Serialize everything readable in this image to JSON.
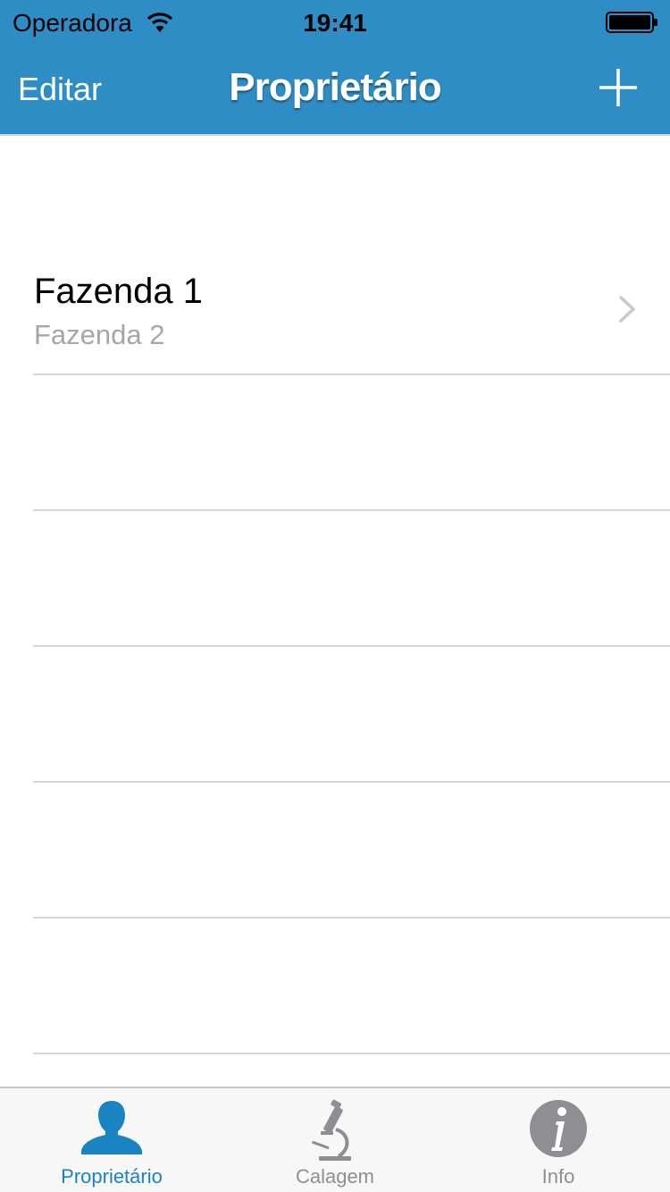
{
  "status_bar": {
    "carrier": "Operadora",
    "time": "19:41"
  },
  "nav_bar": {
    "edit_label": "Editar",
    "title": "Proprietário",
    "add_icon": "plus-icon"
  },
  "list": {
    "rows": [
      {
        "title": "Fazenda 1",
        "subtitle": "Fazenda 2",
        "accessory": "chevron-right-icon"
      },
      {
        "title": "",
        "subtitle": ""
      },
      {
        "title": "",
        "subtitle": ""
      },
      {
        "title": "",
        "subtitle": ""
      },
      {
        "title": "",
        "subtitle": ""
      },
      {
        "title": "",
        "subtitle": ""
      }
    ]
  },
  "tab_bar": {
    "tabs": [
      {
        "label": "Proprietário",
        "icon": "person-icon",
        "selected": true
      },
      {
        "label": "Calagem",
        "icon": "microscope-icon",
        "selected": false
      },
      {
        "label": "Info",
        "icon": "info-icon",
        "selected": false
      }
    ]
  },
  "colors": {
    "nav_background": "#2e8dc4",
    "tab_selected": "#1a84c2",
    "tab_unselected": "#8e8e93",
    "subtitle_gray": "#a6a6aa",
    "separator": "#d6d6d9"
  }
}
